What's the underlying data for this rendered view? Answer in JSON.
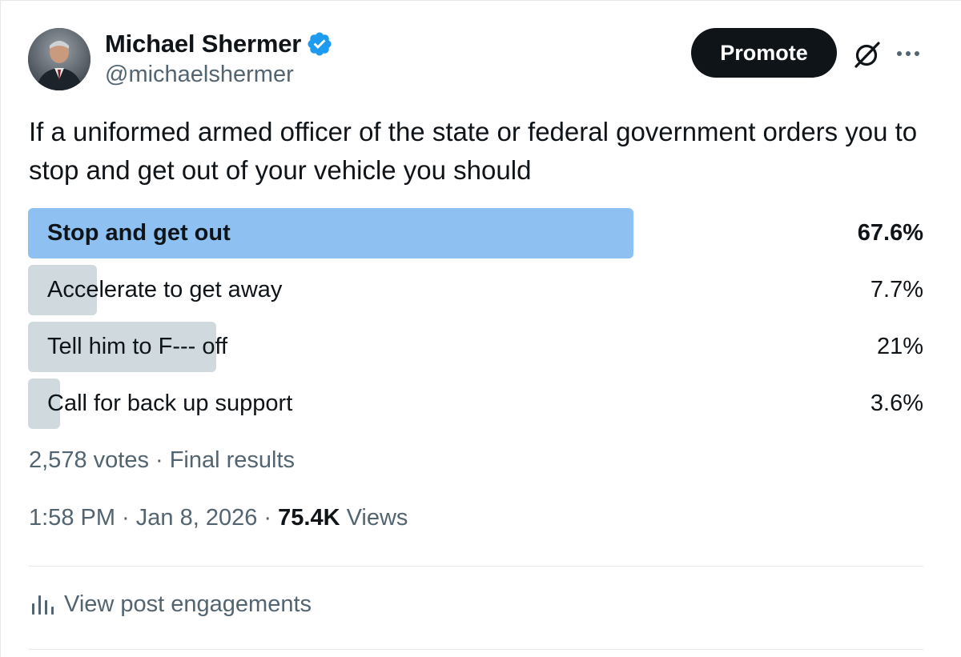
{
  "author": {
    "display_name": "Michael Shermer",
    "handle": "@michaelshermer",
    "verified_icon": "verified-badge-icon",
    "verified_color": "#1d9bf0"
  },
  "header_actions": {
    "promote_label": "Promote",
    "grok_icon": "grok-icon",
    "more_icon": "more-dots-icon"
  },
  "post": {
    "text": "If a uniformed armed officer of the state or federal government orders you to stop and get out of your vehicle you should"
  },
  "poll": {
    "options": [
      {
        "label": "Stop and get out",
        "percent_text": "67.6%",
        "percent": 67.6,
        "winner": true
      },
      {
        "label": "Accelerate to get away",
        "percent_text": "7.7%",
        "percent": 7.7,
        "winner": false
      },
      {
        "label": "Tell him to F--- off",
        "percent_text": "21%",
        "percent": 21,
        "winner": false
      },
      {
        "label": "Call for back up support",
        "percent_text": "3.6%",
        "percent": 3.6,
        "winner": false
      }
    ],
    "summary": "2,578 votes · Final results",
    "winner_color": "#8ec1f2",
    "bar_color": "#cfd9de"
  },
  "meta": {
    "time": "1:58 PM",
    "separator": " · ",
    "date": "Jan 8, 2026",
    "views_count": "75.4K",
    "views_label": " Views"
  },
  "engagements": {
    "label": "View post engagements",
    "icon": "analytics-icon"
  }
}
